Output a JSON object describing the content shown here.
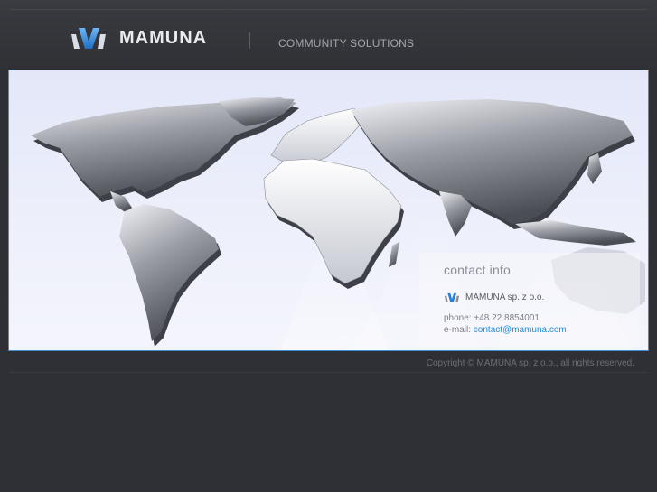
{
  "header": {
    "brand_name": "MAMUNA",
    "tagline": "COMMUNITY SOLUTIONS"
  },
  "contact": {
    "title": "contact info",
    "company": "MAMUNA sp. z o.o.",
    "phone_label": "phone:",
    "phone_value": "+48 22 8854001",
    "email_label": "e-mail:",
    "email_value": "contact@mamuna.com"
  },
  "footer": {
    "copyright": "Copyright © MAMUNA sp. z o.o., all rights reserved."
  },
  "colors": {
    "background": "#2f3035",
    "banner_border": "#3f8ed8",
    "link": "#1a8fe0",
    "logo_blue": "#2a7fd4"
  },
  "icons": [
    "mamuna-logo-icon",
    "world-map-icon"
  ]
}
